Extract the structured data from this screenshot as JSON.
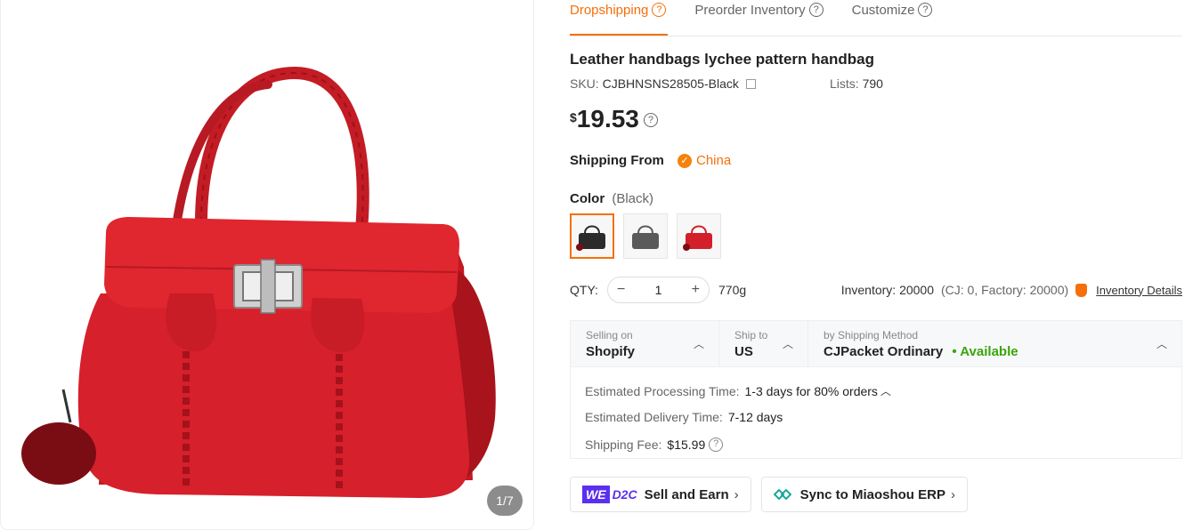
{
  "gallery": {
    "pager": "1/7"
  },
  "tabs": [
    {
      "label": "Dropshipping",
      "active": true
    },
    {
      "label": "Preorder Inventory",
      "active": false
    },
    {
      "label": "Customize",
      "active": false
    }
  ],
  "product": {
    "title": "Leather handbags lychee pattern handbag",
    "sku_label": "SKU:",
    "sku": "CJBHNSNS28505-Black",
    "lists_label": "Lists:",
    "lists": "790",
    "currency": "$",
    "price": "19.53"
  },
  "shipping_from": {
    "label": "Shipping From",
    "country": "China"
  },
  "color": {
    "label": "Color",
    "selected": "(Black)",
    "options": [
      {
        "name": "Black",
        "hex": "#2b2b2b"
      },
      {
        "name": "Gray",
        "hex": "#5a5a5a"
      },
      {
        "name": "Red",
        "hex": "#d21f2a"
      }
    ]
  },
  "qty": {
    "label": "QTY:",
    "minus": "−",
    "value": "1",
    "plus": "+",
    "weight": "770g",
    "inventory": "Inventory: 20000",
    "inventory_detail": "(CJ: 0, Factory: 20000)",
    "inventory_link": "Inventory Details"
  },
  "shipping": {
    "selling_on_label": "Selling on",
    "selling_on": "Shopify",
    "ship_to_label": "Ship to",
    "ship_to": "US",
    "method_label": "by Shipping Method",
    "method": "CJPacket Ordinary",
    "availability": "• Available",
    "processing_label": "Estimated Processing Time:",
    "processing": "1-3 days for 80% orders",
    "delivery_label": "Estimated Delivery Time:",
    "delivery": "7-12 days",
    "fee_label": "Shipping Fee:",
    "fee": "$15.99"
  },
  "actions": {
    "we_logo": "WE",
    "d2c_logo": "D2C",
    "sell_label": "Sell and Earn",
    "sync_label": "Sync to Miaoshou ERP"
  },
  "colors": {
    "accent": "#f56f0a",
    "available": "#3aa40b",
    "we_brand": "#5b2ff0",
    "bag_red": "#d21f2a"
  }
}
